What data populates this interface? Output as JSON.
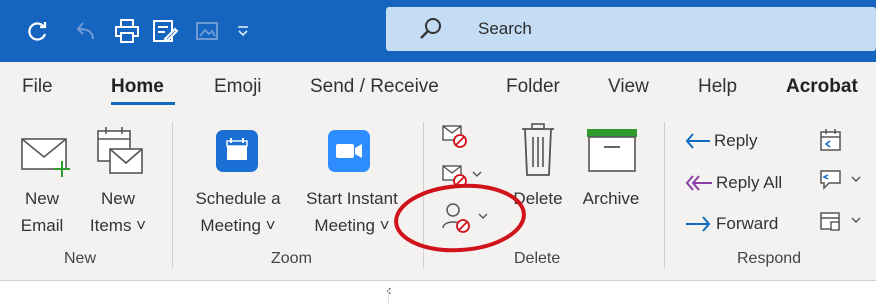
{
  "search": {
    "label": "Search"
  },
  "tabs": [
    "File",
    "Home",
    "Emoji",
    "Send / Receive",
    "Folder",
    "View",
    "Help",
    "Acrobat"
  ],
  "ribbon": {
    "new_group": {
      "label": "New",
      "new_email": [
        "New",
        "Email"
      ],
      "new_items": [
        "New",
        "Items ˅"
      ]
    },
    "zoom_group": {
      "label": "Zoom",
      "schedule": [
        "Schedule a",
        "Meeting ˅"
      ],
      "start": [
        "Start Instant",
        "Meeting ˅"
      ]
    },
    "delete_group": {
      "label": "Delete",
      "delete": "Delete",
      "archive": "Archive"
    },
    "respond_group": {
      "label": "Respond",
      "reply": "Reply",
      "reply_all": "Reply All",
      "forward": "Forward"
    }
  },
  "colors": {
    "titlebar": "#1565c0",
    "accent": "#0f6cbd",
    "annotation": "#d0121a",
    "zoom_blue": "#2d8cff"
  }
}
